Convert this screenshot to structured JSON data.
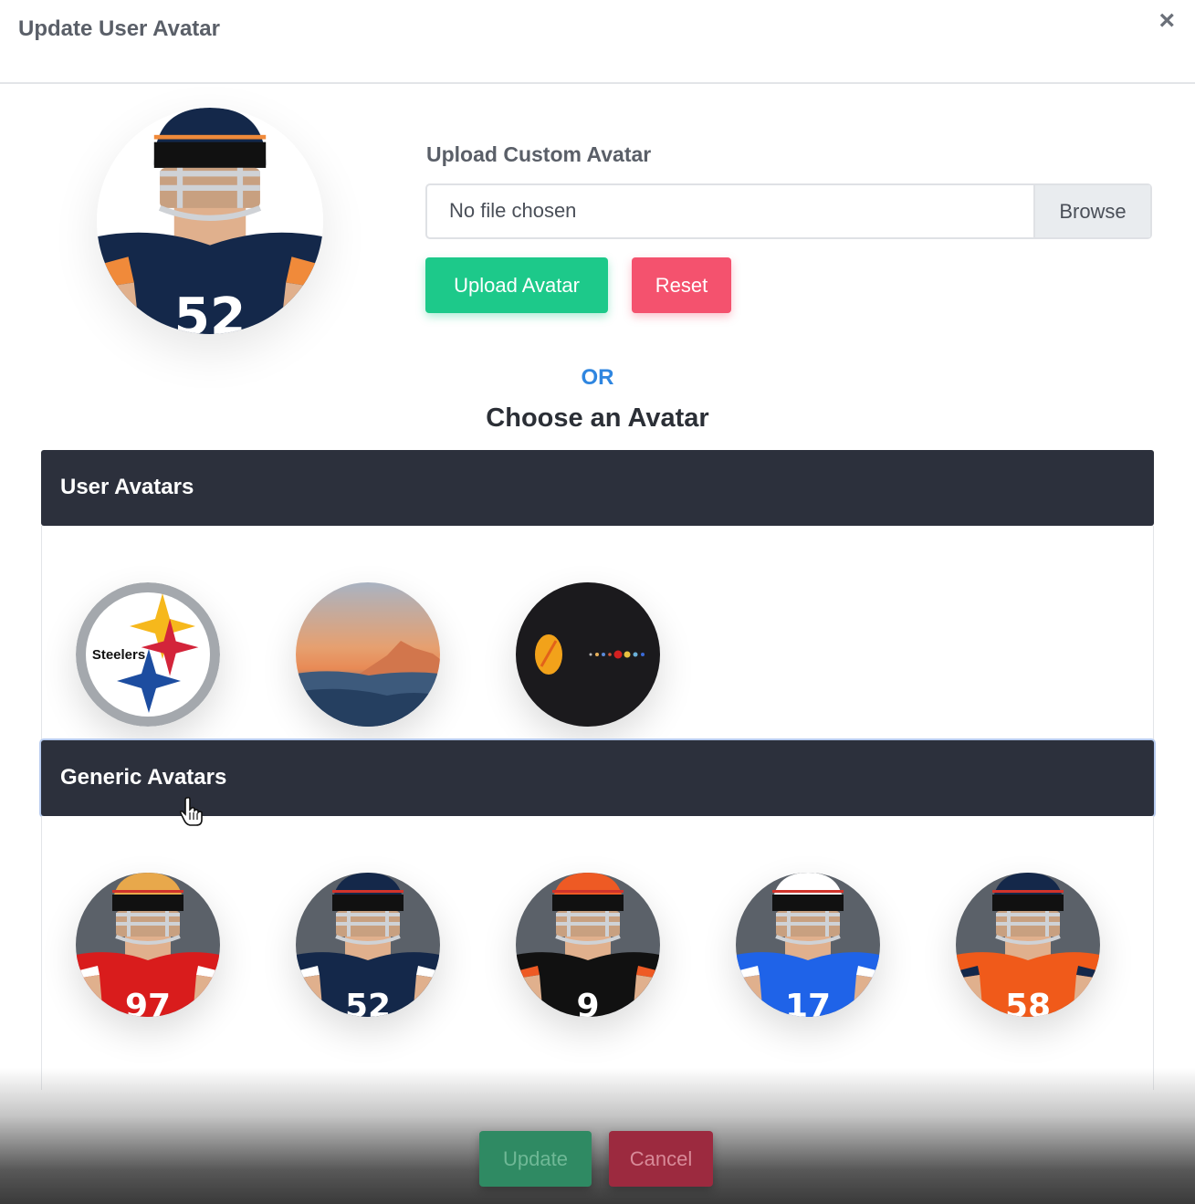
{
  "modal": {
    "title": "Update User Avatar",
    "close_label": "×"
  },
  "upload": {
    "label": "Upload Custom Avatar",
    "file_status": "No file chosen",
    "browse_label": "Browse",
    "upload_button": "Upload Avatar",
    "reset_button": "Reset"
  },
  "divider": {
    "or_text": "OR",
    "choose_title": "Choose an Avatar"
  },
  "sections": {
    "user": {
      "title": "User Avatars",
      "avatars": [
        {
          "name": "steelers-logo",
          "text": "Steelers"
        },
        {
          "name": "mountain-sunset"
        },
        {
          "name": "solar-system"
        }
      ]
    },
    "generic": {
      "title": "Generic Avatars",
      "avatars": [
        {
          "number": "97",
          "jersey": "#d91c1c",
          "helmet": "#e8a84b"
        },
        {
          "number": "52",
          "jersey": "#14284a",
          "helmet": "#14284a"
        },
        {
          "number": "9",
          "jersey": "#111111",
          "helmet": "#ee5a24"
        },
        {
          "number": "17",
          "jersey": "#1f63e8",
          "helmet": "#ffffff"
        },
        {
          "number": "58",
          "jersey": "#f05a1a",
          "helmet": "#14284a"
        }
      ]
    }
  },
  "current_avatar": {
    "number": "52",
    "jersey": "#14284a",
    "helmet": "#14284a"
  },
  "footer": {
    "update_button": "Update",
    "cancel_button": "Cancel"
  },
  "colors": {
    "primary_green": "#1dc98a",
    "danger_pink": "#f4526e",
    "link_blue": "#2f86e0",
    "section_header": "#2c303c"
  }
}
